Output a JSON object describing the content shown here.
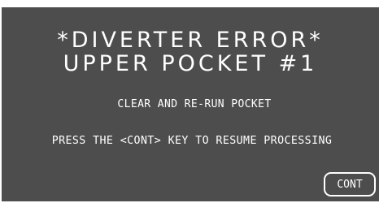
{
  "screen": {
    "title_line1": "*DIVERTER ERROR*",
    "title_line2": "UPPER POCKET #1",
    "instruction": "CLEAR AND RE-RUN POCKET",
    "prompt": "PRESS THE <CONT> KEY TO RESUME PROCESSING"
  },
  "buttons": {
    "cont_label": "CONT"
  },
  "colors": {
    "screen_background": "#4d4d4d",
    "text": "#ffffff"
  }
}
